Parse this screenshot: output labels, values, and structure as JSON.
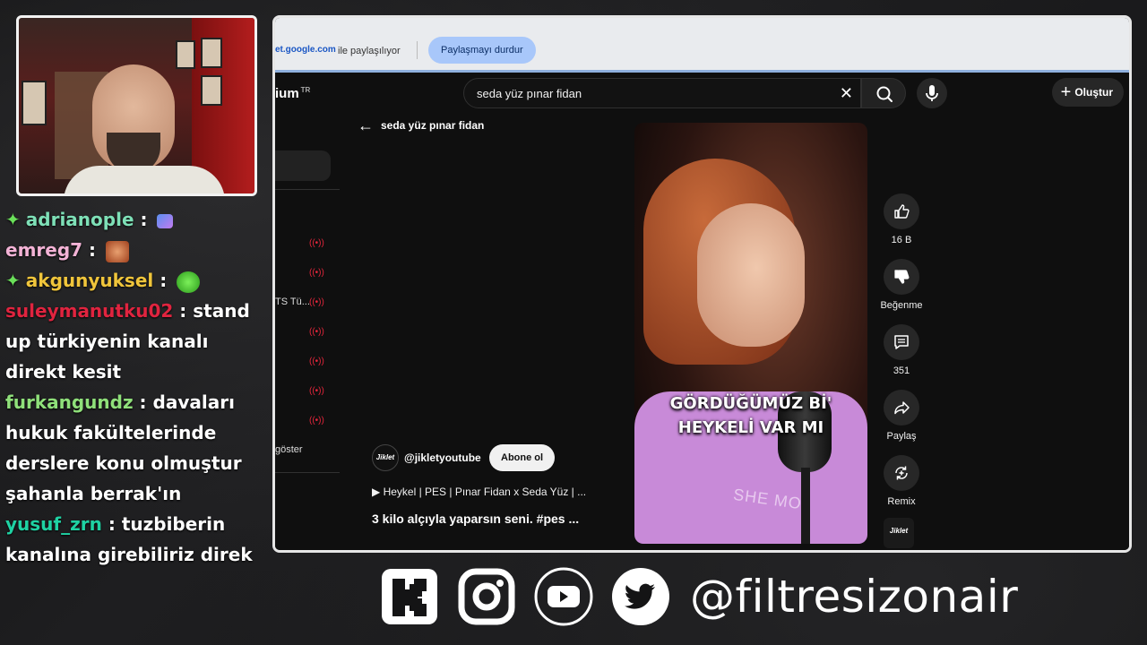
{
  "chat": [
    {
      "user": "adrianople",
      "user_color": "#7ee0b7",
      "badge": true,
      "message": ""
    },
    {
      "user": "emreg7",
      "user_color": "#f3b3d6",
      "badge": false,
      "message": ""
    },
    {
      "user": "akgunyuksel",
      "user_color": "#f0c53b",
      "badge": true,
      "message": ""
    },
    {
      "user": "suleymanutku02",
      "user_color": "#e0243f",
      "badge": false,
      "message": "stand up türkiyenin kanalı direkt kesit"
    },
    {
      "user": "furkangundz",
      "user_color": "#8fe07a",
      "badge": false,
      "message": "davaları hukuk fakültelerinde derslere konu olmuştur şahanla berrak'ın"
    },
    {
      "user": "yusuf_zrn",
      "user_color": "#1fd2a3",
      "badge": false,
      "message": "tuzbiberin kanalına girebiliriz direk"
    }
  ],
  "sharebar": {
    "url": "et.google.com",
    "sharing_text": "ile paylaşılıyor",
    "stop_label": "Paylaşmayı durdur"
  },
  "youtube": {
    "logo_text": "ium",
    "logo_region": "TR",
    "search_value": "seda yüz pınar fidan",
    "create_label": "Oluştur",
    "back_label": "seda yüz pınar fidan",
    "sidebar_partial_1": "TS Tü...",
    "sidebar_partial_2": "göster",
    "video_caption_1": "GÖRDÜĞÜMÜZ Bİ'",
    "video_caption_2": "HEYKELİ VAR MI",
    "shirt_print": "SHE MO",
    "channel_avatar": "Jiklet",
    "channel_name": "@jikletyoutube",
    "subscribe_label": "Abone ol",
    "playlist": "▶ Heykel | PES | Pınar Fidan x Seda Yüz | ...",
    "video_title": "3 kilo alçıyla yaparsın seni. #pes ...",
    "actions": {
      "like_count": "16 B",
      "dislike_label": "Beğenme",
      "comment_count": "351",
      "share_label": "Paylaş",
      "remix_label": "Remix"
    }
  },
  "social": {
    "handle": "@filtresizonair",
    "icons": [
      "kick-icon",
      "instagram-icon",
      "youtube-icon",
      "twitter-icon"
    ]
  },
  "colors": {
    "live_red": "#e4253b",
    "stop_button_bg": "#a8c7fa",
    "yt_bg": "#0f0f0f"
  }
}
